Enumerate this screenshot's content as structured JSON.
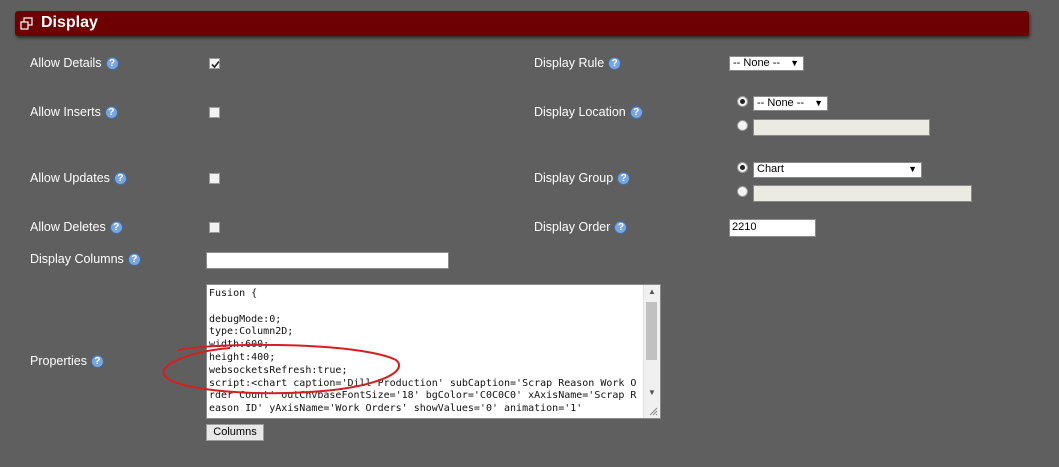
{
  "header": {
    "title": "Display",
    "icon": "window-restore-icon"
  },
  "help_glyph": "?",
  "left": {
    "allow_details": {
      "label": "Allow Details",
      "checked": true
    },
    "allow_inserts": {
      "label": "Allow Inserts",
      "checked": false
    },
    "allow_updates": {
      "label": "Allow Updates",
      "checked": false
    },
    "allow_deletes": {
      "label": "Allow Deletes",
      "checked": false
    },
    "display_columns": {
      "label": "Display Columns",
      "value": ""
    },
    "properties": {
      "label": "Properties",
      "text": "Fusion {\n\ndebugMode:0;\ntype:Column2D;\nwidth:600;\nheight:400;\nwebsocketsRefresh:true;\nscript:<chart caption='Dill Production' subCaption='Scrap Reason Work Order Count' outCnvbaseFontSize='18' bgColor='C0C0C0' xAxisName='Scrap Reason ID' yAxisName='Work Orders' showValues='0' animation='1'",
      "columns_button": "Columns"
    }
  },
  "right": {
    "display_rule": {
      "label": "Display Rule",
      "selected": "-- None --"
    },
    "display_location": {
      "label": "Display Location",
      "selected": "-- None --",
      "custom_value": ""
    },
    "display_group": {
      "label": "Display Group",
      "selected": "Chart",
      "custom_value": ""
    },
    "display_order": {
      "label": "Display Order",
      "value": "2210"
    }
  },
  "colors": {
    "header": "#6d0000",
    "background": "#5f5f5f",
    "annotation": "#d42020"
  }
}
